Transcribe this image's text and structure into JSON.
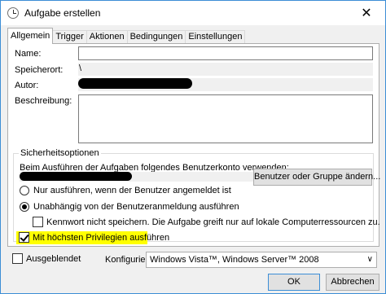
{
  "window": {
    "title": "Aufgabe erstellen",
    "close_glyph": "✕"
  },
  "tabs": [
    {
      "label": "Allgemein",
      "active": true
    },
    {
      "label": "Trigger"
    },
    {
      "label": "Aktionen"
    },
    {
      "label": "Bedingungen"
    },
    {
      "label": "Einstellungen"
    }
  ],
  "general": {
    "name_label": "Name:",
    "name_value": "",
    "location_label": "Speicherort:",
    "location_value": "\\",
    "author_label": "Autor:",
    "description_label": "Beschreibung:",
    "description_value": ""
  },
  "security": {
    "legend": "Sicherheitsoptionen",
    "account_prompt": "Beim Ausführen der Aufgaben folgendes Benutzerkonto verwenden:",
    "change_user_button": "Benutzer oder Gruppe ändern...",
    "radio_logged_on": "Nur ausführen, wenn der Benutzer angemeldet ist",
    "radio_whether_logged_on": "Unabhängig von der Benutzeranmeldung ausführen",
    "no_store_password": "Kennwort nicht speichern. Die Aufgabe greift nur auf lokale Computerressourcen zu.",
    "highest_privileges": "Mit höchsten Privilegien ausführen"
  },
  "footer": {
    "hidden_label": "Ausgeblendet",
    "configure_label": "Konfigurieren für:",
    "configure_value": "Windows Vista™, Windows Server™ 2008",
    "ok_label": "OK",
    "cancel_label": "Abbrechen"
  },
  "colors": {
    "highlight": "#ffff00",
    "accent_border": "#3c8ed6"
  }
}
